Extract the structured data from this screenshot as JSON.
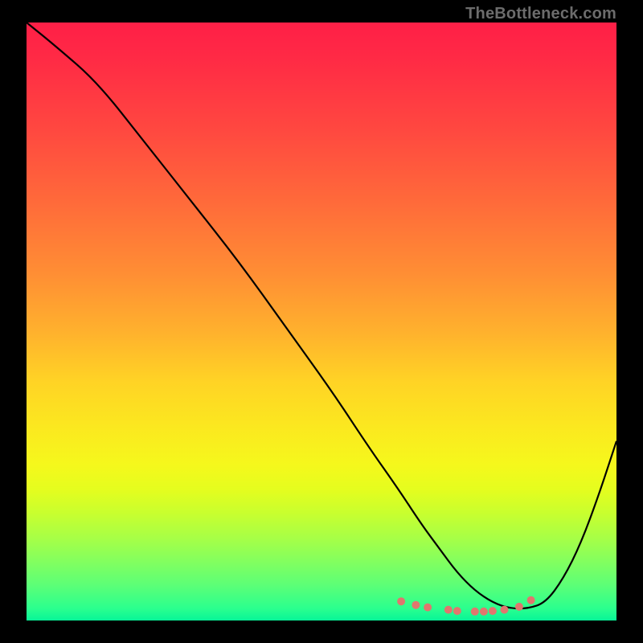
{
  "watermark": "TheBottleneck.com",
  "colors": {
    "background": "#000000",
    "curve": "#000000",
    "dots": "#e0766e",
    "gradient_top": "#ff1f47",
    "gradient_bottom": "#07f598"
  },
  "chart_data": {
    "type": "line",
    "title": "",
    "xlabel": "",
    "ylabel": "",
    "xlim": [
      0,
      100
    ],
    "ylim": [
      0,
      100
    ],
    "grid": false,
    "series": [
      {
        "name": "bottleneck-curve",
        "x": [
          0,
          5,
          12,
          20,
          28,
          36,
          44,
          52,
          58,
          63,
          67,
          70,
          73,
          76,
          79,
          82,
          85,
          88,
          91,
          94,
          97,
          100
        ],
        "values": [
          100,
          96,
          90,
          80,
          70,
          60,
          49,
          38,
          29,
          22,
          16,
          12,
          8,
          5,
          3,
          2,
          2,
          3,
          7,
          13,
          21,
          30
        ]
      }
    ],
    "markers": {
      "name": "highlight-dots",
      "x": [
        63.5,
        66.0,
        68.0,
        71.5,
        73.0,
        76.0,
        77.5,
        79.0,
        81.0,
        83.5,
        85.5
      ],
      "values": [
        3.2,
        2.6,
        2.2,
        1.8,
        1.6,
        1.5,
        1.5,
        1.6,
        1.8,
        2.3,
        3.4
      ]
    }
  }
}
